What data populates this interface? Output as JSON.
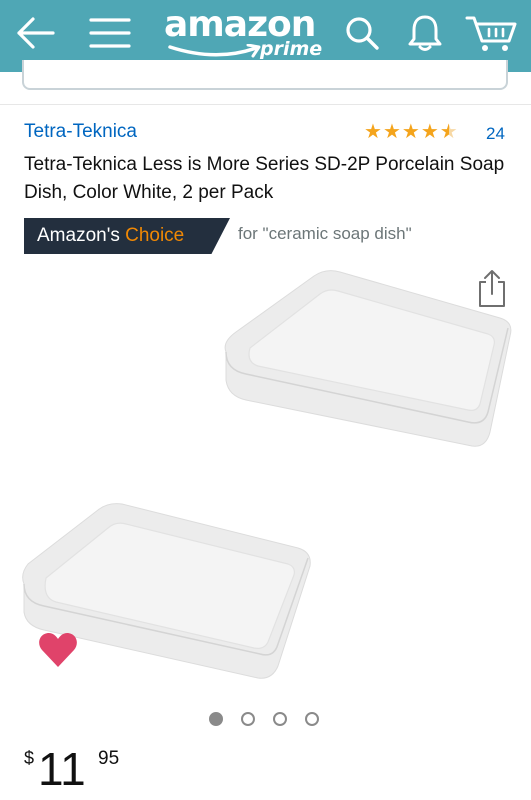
{
  "header": {
    "logo_text": "amazon",
    "logo_sub": "prime",
    "background": "#4fa7b5",
    "icons": [
      "back-arrow-icon",
      "hamburger-menu-icon",
      "search-icon",
      "bell-icon",
      "cart-icon"
    ]
  },
  "product": {
    "brand": "Tetra-Teknica",
    "rating_stars": 4.5,
    "rating_count": "24",
    "title": "Tetra-Teknica Less is More Series SD-2P Porcelain Soap Dish, Color White, 2 per Pack",
    "badge": {
      "prefix": "Amazon's ",
      "highlight": "Choice",
      "for_text": "for \"ceramic soap dish\""
    },
    "image": {
      "dot_count": 4,
      "active_dot": 0
    },
    "price": {
      "currency": "$",
      "whole": "11",
      "fraction": "95"
    }
  },
  "colors": {
    "link": "#0066c0",
    "star": "#f4a41c",
    "badge_bg": "#232f3e",
    "badge_highlight": "#f08804",
    "heart": "#e0436a"
  }
}
